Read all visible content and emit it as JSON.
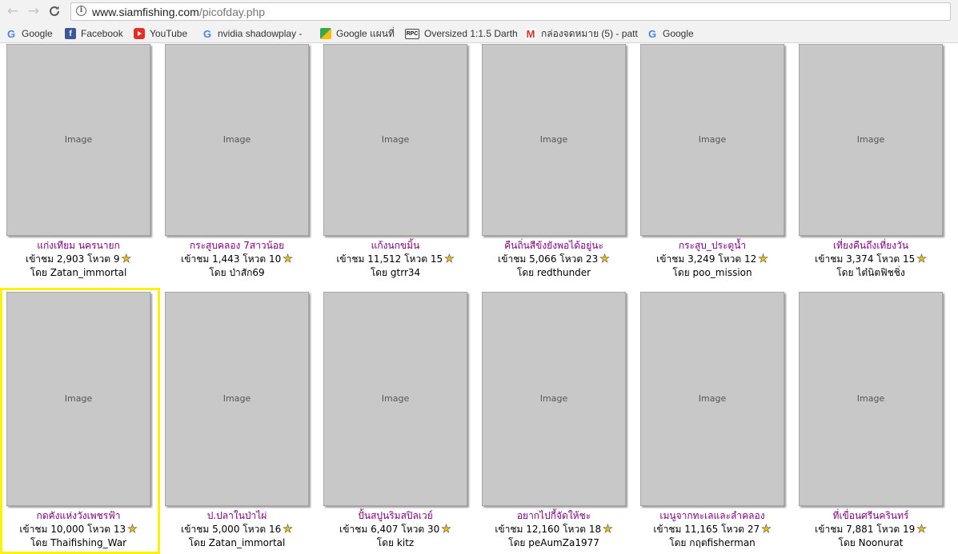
{
  "browser": {
    "url_host": "www.siamfishing.com",
    "url_path": "/picofday.php",
    "bookmarks": [
      {
        "label": "Google",
        "icon": "google-icon"
      },
      {
        "label": "Facebook",
        "icon": "facebook-icon"
      },
      {
        "label": "YouTube",
        "icon": "youtube-icon"
      },
      {
        "label": "nvidia shadowplay - ",
        "icon": "google-icon"
      },
      {
        "label": "Google แผนที่",
        "icon": "maps-icon"
      },
      {
        "label": "Oversized 1:1.5 Darth",
        "icon": "rpc-icon"
      },
      {
        "label": "กล่องจดหมาย (5) - patt",
        "icon": "gmail-icon"
      },
      {
        "label": "Google",
        "icon": "google-icon"
      }
    ]
  },
  "cards": [
    {
      "title": "แก่งเทียม นครนายก",
      "views_label": "เข้าชม",
      "views": "2,903",
      "votes_label": "โหวต",
      "votes": "9",
      "by_label": "โดย",
      "author": "Zatan_immortal"
    },
    {
      "title": "กระสูบคลอง 7สาวน้อย",
      "views_label": "เข้าชม",
      "views": "1,443",
      "votes_label": "โหวต",
      "votes": "10",
      "by_label": "โดย",
      "author": "ป่าสัก69"
    },
    {
      "title": "แก้งนกขมิ้น",
      "views_label": "เข้าชม",
      "views": "11,512",
      "votes_label": "โหวต",
      "votes": "15",
      "by_label": "โดย",
      "author": "gtrr34"
    },
    {
      "title": "คืนถิ่นสีข้งยังพอได้อยู่นะ",
      "views_label": "เข้าชม",
      "views": "5,066",
      "votes_label": "โหวต",
      "votes": "23",
      "by_label": "โดย",
      "author": "redthunder"
    },
    {
      "title": "กระสูบ_ประตูน้ำ",
      "views_label": "เข้าชม",
      "views": "3,249",
      "votes_label": "โหวต",
      "votes": "12",
      "by_label": "โดย",
      "author": "poo_mission"
    },
    {
      "title": "เที่ยงคืนถึงเที่ยงวัน",
      "views_label": "เข้าชม",
      "views": "3,374",
      "votes_label": "โหวต",
      "votes": "15",
      "by_label": "โดย",
      "author": "ไต๋นิตฟิชชิ่ง"
    },
    {
      "title": "กดคังแห่งวังเพชรฟ้า",
      "views_label": "เข้าชม",
      "views": "10,000",
      "votes_label": "โหวต",
      "votes": "13",
      "by_label": "โดย",
      "author": "Thaifishing_War"
    },
    {
      "title": "ป.ปลาในป่าไผ่",
      "views_label": "เข้าชม",
      "views": "5,000",
      "votes_label": "โหวต",
      "votes": "16",
      "by_label": "โดย",
      "author": "Zatan_immortal"
    },
    {
      "title": "ปั้นสปูนริมสปิลเวย์",
      "views_label": "เข้าชม",
      "views": "6,407",
      "votes_label": "โหวต",
      "votes": "30",
      "by_label": "โดย",
      "author": "kitz"
    },
    {
      "title": "อยากไปกี้จัดให้ชะ",
      "views_label": "เข้าชม",
      "views": "12,160",
      "votes_label": "โหวต",
      "votes": "18",
      "by_label": "โดย",
      "author": "peAumZa1977"
    },
    {
      "title": "เมนูจากทะเลและลำคลอง",
      "views_label": "เข้าชม",
      "views": "11,165",
      "votes_label": "โหวต",
      "votes": "27",
      "by_label": "โดย",
      "author": "กฤตfisherman"
    },
    {
      "title": "ที่เขื่อนศรีนครินทร์",
      "views_label": "เข้าชม",
      "views": "7,881",
      "votes_label": "โหวต",
      "votes": "19",
      "by_label": "โดย",
      "author": "Noonurat"
    }
  ],
  "colors": {
    "title_link": "#800080",
    "highlight_border": "#fff200",
    "star": "#f2c200"
  }
}
